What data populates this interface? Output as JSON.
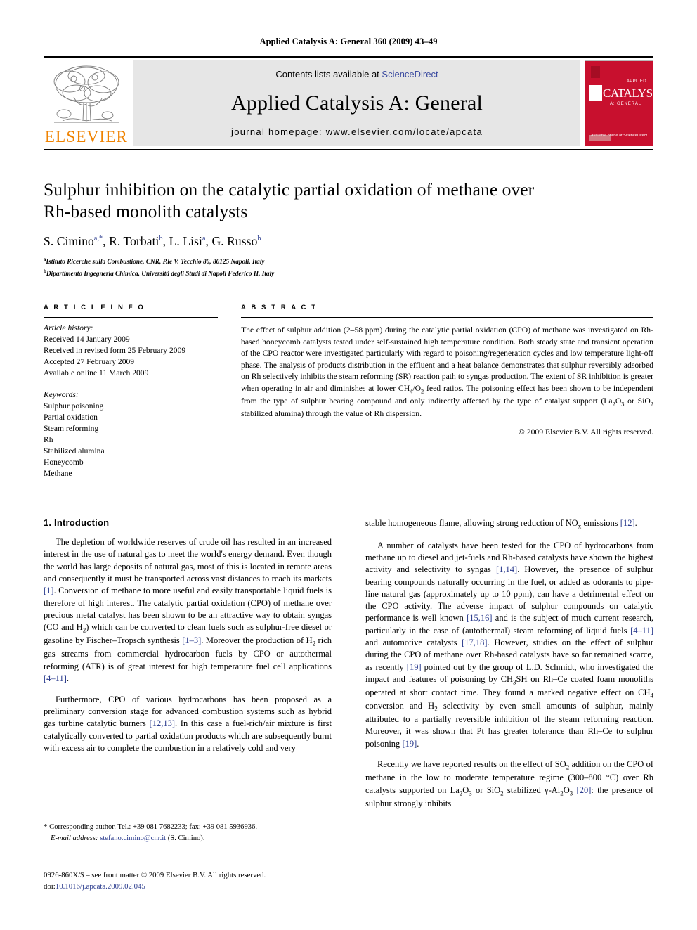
{
  "running_head": "Applied Catalysis A: General 360 (2009) 43–49",
  "banner": {
    "publisher_name": "ELSEVIER",
    "contents_prefix": "Contents lists available at ",
    "contents_link": "ScienceDirect",
    "journal_title": "Applied Catalysis A: General",
    "homepage": "journal homepage: www.elsevier.com/locate/apcata",
    "cover": {
      "words": "CATALYSIS",
      "applied": "APPLIED",
      "general": "A: GENERAL",
      "bottom": "Available online at\nScienceDirect"
    }
  },
  "article": {
    "title_line1": "Sulphur inhibition on the catalytic partial oxidation of methane over",
    "title_line2": "Rh-based monolith catalysts",
    "authors": [
      {
        "name": "S. Cimino",
        "marks": "a,*"
      },
      {
        "name": "R. Torbati",
        "marks": "b"
      },
      {
        "name": "L. Lisi",
        "marks": "a"
      },
      {
        "name": "G. Russo",
        "marks": "b"
      }
    ],
    "affiliations": [
      {
        "mark": "a",
        "text": "Istituto Ricerche sulla Combustione, CNR, P.le V. Tecchio 80, 80125 Napoli, Italy"
      },
      {
        "mark": "b",
        "text": "Dipartimento Ingegneria Chimica, Università degli Studi di Napoli Federico II, Italy"
      }
    ]
  },
  "article_info": {
    "heading": "A R T I C L E   I N F O",
    "history_label": "Article history:",
    "history": [
      "Received 14 January 2009",
      "Received in revised form 25 February 2009",
      "Accepted 27 February 2009",
      "Available online 11 March 2009"
    ],
    "keywords_label": "Keywords:",
    "keywords": [
      "Sulphur poisoning",
      "Partial oxidation",
      "Steam reforming",
      "Rh",
      "Stabilized alumina",
      "Honeycomb",
      "Methane"
    ]
  },
  "abstract": {
    "heading": "A B S T R A C T",
    "text": "The effect of sulphur addition (2–58 ppm) during the catalytic partial oxidation (CPO) of methane was investigated on Rh-based honeycomb catalysts tested under self-sustained high temperature condition. Both steady state and transient operation of the CPO reactor were investigated particularly with regard to poisoning/regeneration cycles and low temperature light-off phase. The analysis of products distribution in the effluent and a heat balance demonstrates that sulphur reversibly adsorbed on Rh selectively inhibits the steam reforming (SR) reaction path to syngas production. The extent of SR inhibition is greater when operating in air and diminishes at lower CH4/O2 feed ratios. The poisoning effect has been shown to be independent from the type of sulphur bearing compound and only indirectly affected by the type of catalyst support (La2O3 or SiO2 stabilized alumina) through the value of Rh dispersion.",
    "copyright": "© 2009 Elsevier B.V. All rights reserved."
  },
  "section": {
    "intro_heading": "1. Introduction",
    "left_paragraphs": [
      "The depletion of worldwide reserves of crude oil has resulted in an increased interest in the use of natural gas to meet the world's energy demand. Even though the world has large deposits of natural gas, most of this is located in remote areas and consequently it must be transported across vast distances to reach its markets [1]. Conversion of methane to more useful and easily transportable liquid fuels is therefore of high interest. The catalytic partial oxidation (CPO) of methane over precious metal catalyst has been shown to be an attractive way to obtain syngas (CO and H2) which can be converted to clean fuels such as sulphur-free diesel or gasoline by Fischer–Tropsch synthesis [1–3]. Moreover the production of H2 rich gas streams from commercial hydrocarbon fuels by CPO or autothermal reforming (ATR) is of great interest for high temperature fuel cell applications [4–11].",
      "Furthermore, CPO of various hydrocarbons has been proposed as a preliminary conversion stage for advanced combustion systems such as hybrid gas turbine catalytic burners [12,13]. In this case a fuel-rich/air mixture is first catalytically converted to partial oxidation products which are subsequently burnt with excess air to complete the combustion in a relatively cold and very"
    ],
    "right_paragraphs": [
      "stable homogeneous flame, allowing strong reduction of NOx emissions [12].",
      "A number of catalysts have been tested for the CPO of hydrocarbons from methane up to diesel and jet-fuels and Rh-based catalysts have shown the highest activity and selectivity to syngas [1,14]. However, the presence of sulphur bearing compounds naturally occurring in the fuel, or added as odorants to pipe-line natural gas (approximately up to 10 ppm), can have a detrimental effect on the CPO activity. The adverse impact of sulphur compounds on catalytic performance is well known [15,16] and is the subject of much current research, particularly in the case of (autothermal) steam reforming of liquid fuels [4–11] and automotive catalysts [17,18]. However, studies on the effect of sulphur during the CPO of methane over Rh-based catalysts have so far remained scarce, as recently [19] pointed out by the group of L.D. Schmidt, who investigated the impact and features of poisoning by CH3SH on Rh–Ce coated foam monoliths operated at short contact time. They found a marked negative effect on CH4 conversion and H2 selectivity by even small amounts of sulphur, mainly attributed to a partially reversible inhibition of the steam reforming reaction. Moreover, it was shown that Pt has greater tolerance than Rh–Ce to sulphur poisoning [19].",
      "Recently we have reported results on the effect of SO2 addition on the CPO of methane in the low to moderate temperature regime (300–800 °C) over Rh catalysts supported on La2O3 or SiO2 stabilized γ-Al2O3 [20]: the presence of sulphur strongly inhibits"
    ]
  },
  "footnote": {
    "star": "*",
    "corresponding": "Corresponding author. Tel.: +39 081 7682233; fax: +39 081 5936936.",
    "email_label": "E-mail address:",
    "email": "stefano.cimino@cnr.it",
    "email_owner": "(S. Cimino)."
  },
  "footer": {
    "issn_line": "0926-860X/$ – see front matter © 2009 Elsevier B.V. All rights reserved.",
    "doi_label": "doi:",
    "doi": "10.1016/j.apcata.2009.02.045"
  },
  "colors": {
    "elsevier_orange": "#ef8200",
    "link_blue": "#2b3c8e",
    "cover_red": "#c8102e",
    "banner_grey": "#e6e6e6"
  }
}
